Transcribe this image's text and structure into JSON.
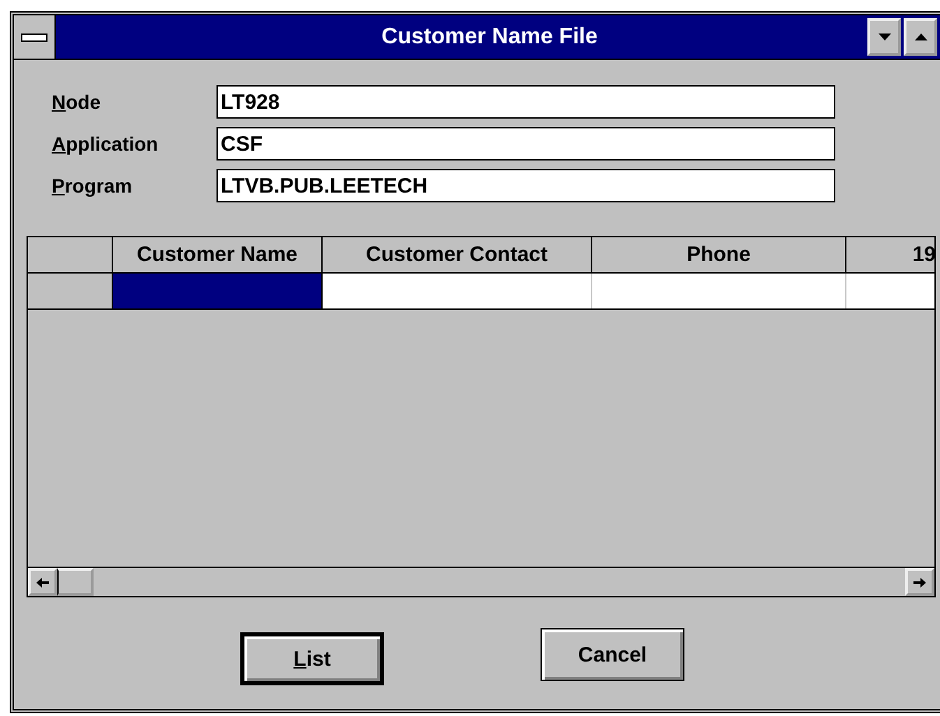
{
  "window": {
    "title": "Customer Name File"
  },
  "fields": [
    {
      "label": "Node",
      "mnemonic": true,
      "value": "LT928"
    },
    {
      "label": "Application",
      "mnemonic": true,
      "value": "CSF"
    },
    {
      "label": "Program",
      "mnemonic": true,
      "value": "LTVB.PUB.LEETECH"
    }
  ],
  "table": {
    "columns": [
      "Customer Name",
      "Customer Contact",
      "Phone",
      "19"
    ],
    "rows": [
      {
        "cells": [
          {
            "selected": true
          },
          {
            "selected": false
          },
          {
            "selected": false
          },
          {
            "selected": false
          }
        ]
      }
    ]
  },
  "buttons": [
    {
      "label": "List",
      "mnemonic": true,
      "default": true
    },
    {
      "label": "Cancel",
      "mnemonic": false,
      "default": false
    }
  ]
}
